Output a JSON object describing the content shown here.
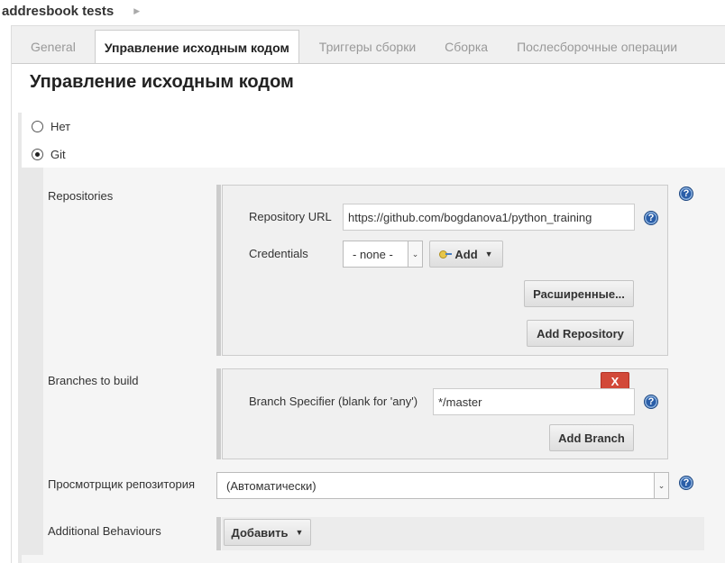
{
  "breadcrumb": {
    "job_name": "addresbook tests"
  },
  "tabs": [
    {
      "label": "General"
    },
    {
      "label": "Управление исходным кодом"
    },
    {
      "label": "Триггеры сборки"
    },
    {
      "label": "Сборка"
    },
    {
      "label": "Послесборочные операции"
    }
  ],
  "section": {
    "title": "Управление исходным кодом"
  },
  "scm_options": [
    {
      "label": "Нет",
      "checked": false
    },
    {
      "label": "Git",
      "checked": true
    }
  ],
  "repositories": {
    "label": "Repositories",
    "url_label": "Repository URL",
    "url_value": "https://github.com/bogdanova1/python_training",
    "credentials_label": "Credentials",
    "credentials_value": "- none -",
    "add_label": "Add",
    "advanced_label": "Расширенные...",
    "add_repository_label": "Add Repository"
  },
  "branches": {
    "label": "Branches to build",
    "delete_label": "X",
    "specifier_label": "Branch Specifier (blank for 'any')",
    "specifier_value": "*/master",
    "add_branch_label": "Add Branch"
  },
  "browser": {
    "label": "Просмотрщик репозитория",
    "value": "(Автоматически)"
  },
  "behaviours": {
    "label": "Additional Behaviours",
    "add_label": "Добавить"
  },
  "help_glyph": "?",
  "icons": [
    "chevron-right-icon",
    "help-icon",
    "key-icon",
    "caret-down-icon"
  ]
}
